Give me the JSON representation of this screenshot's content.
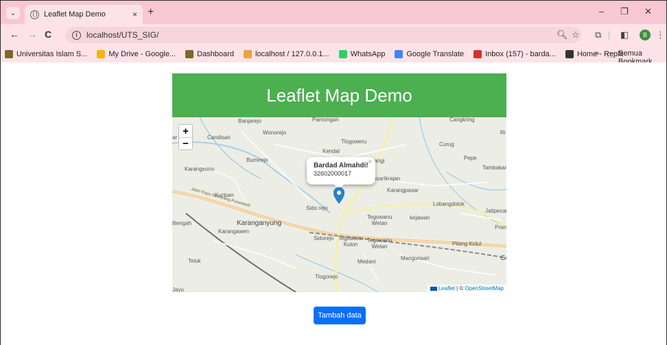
{
  "browser": {
    "tab_title": "Leaflet Map Demo",
    "new_tab": "+",
    "tab_close": "×",
    "url": "localhost/UTS_SIG/",
    "profile_initial": "B",
    "window_controls": {
      "minimize": "–",
      "restore": "❐",
      "close": "✕"
    }
  },
  "bookmarks": [
    {
      "label": "Universitas Islam S...",
      "icon": "university-icon",
      "color": "#7a6a2a"
    },
    {
      "label": "My Drive - Google...",
      "icon": "google-drive-icon",
      "color": "#f4b400"
    },
    {
      "label": "Dashboard",
      "icon": "dashboard-icon",
      "color": "#7a6a2a"
    },
    {
      "label": "localhost / 127.0.0.1...",
      "icon": "phpmyadmin-icon",
      "color": "#e8a33d"
    },
    {
      "label": "WhatsApp",
      "icon": "whatsapp-icon",
      "color": "#25d366"
    },
    {
      "label": "Google Translate",
      "icon": "google-translate-icon",
      "color": "#4285f4"
    },
    {
      "label": "Inbox (157) - barda...",
      "icon": "gmail-icon",
      "color": "#d93025"
    },
    {
      "label": "Home - Replit",
      "icon": "replit-icon",
      "color": "#333333"
    }
  ],
  "bookmarks_overflow": "»",
  "all_bookmarks": "Semua Bookmark",
  "page": {
    "title": "Leaflet Map Demo",
    "header_color": "#4caf50",
    "button_label": "Tambah data",
    "button_color": "#0d6efd"
  },
  "map": {
    "zoom_in": "+",
    "zoom_out": "−",
    "popup_title": "Bardad Almahdi!",
    "popup_text": "32602000017",
    "popup_close": "×",
    "attribution_leaflet": "Leaflet",
    "attribution_sep": " | © ",
    "attribution_osm": "OpenStreetMap",
    "places": [
      "Banjarejo",
      "Pamongan",
      "Cangkring",
      "Wonorejo",
      "Candisari",
      "Tlogoweru",
      "Curug",
      "Kendal",
      "Bumirejo",
      "Mlangi",
      "Pepe",
      "Tambakan",
      "Karangsono",
      "imsarikrajan",
      "Karangpasar",
      "Kuripan",
      "Lobangdolok",
      "Sido rejo",
      "Jatipecar",
      "Tegowanu Wetan",
      "kejawan",
      "Karanganyung",
      "Karangawen",
      "Sidorejo",
      "Tegowanu Kulon",
      "Tegowanu Wetan",
      "Pilang Kidul",
      "Teluk",
      "Medani",
      "Mangunsari",
      "Tlogorejo",
      "Ri",
      "Pran",
      "Ge",
      "iltengah",
      "ar",
      "Jalan Raya Semarang-Purwodadi",
      "P",
      "Jayu"
    ]
  }
}
